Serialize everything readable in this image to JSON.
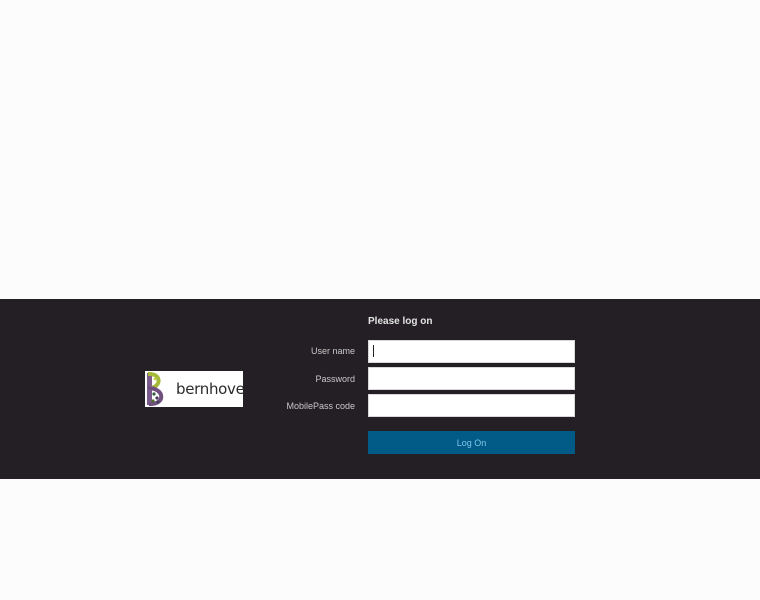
{
  "login": {
    "title": "Please log on",
    "fields": [
      {
        "label": "User name",
        "value": "",
        "placeholder": ""
      },
      {
        "label": "Password",
        "value": "",
        "placeholder": ""
      },
      {
        "label": "MobilePass code",
        "value": "",
        "placeholder": ""
      }
    ],
    "submit_label": "Log On"
  },
  "logo": {
    "text": "bernhoven",
    "icon": "stylized-letter-b-logo"
  },
  "colors": {
    "page_background": "#fcfcfc",
    "band_background": "#231f24",
    "button_background": "#025a87",
    "button_text": "#7bc8e8"
  }
}
